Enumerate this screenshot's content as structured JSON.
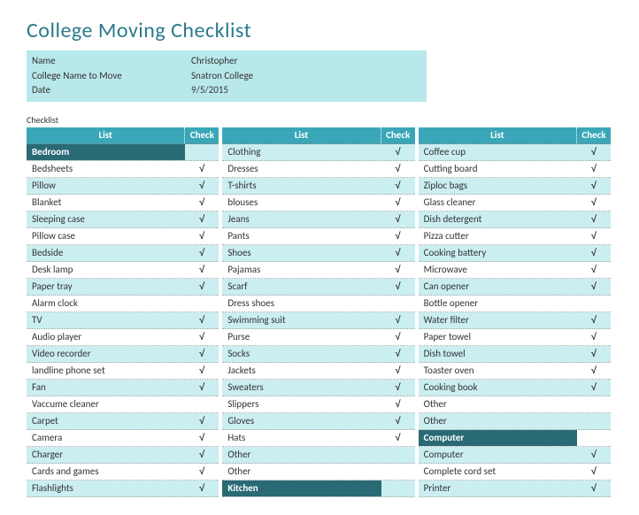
{
  "title": "College Moving Checklist",
  "info": {
    "name_label": "Name",
    "name_value": "Christopher",
    "college_label": "College Name to Move",
    "college_value": "Snatron College",
    "date_label": "Date",
    "date_value": "9/5/2015"
  },
  "section_label": "Checklist",
  "headers": {
    "list": "List",
    "check": "Check"
  },
  "checkmark": "√",
  "columns": [
    [
      {
        "label": "Bedroom",
        "check": "",
        "cat": true
      },
      {
        "label": "Bedsheets",
        "check": "√"
      },
      {
        "label": "Pillow",
        "check": "√"
      },
      {
        "label": "Blanket",
        "check": "√"
      },
      {
        "label": "Sleeping case",
        "check": "√"
      },
      {
        "label": "Pillow case",
        "check": "√"
      },
      {
        "label": "Bedside",
        "check": "√"
      },
      {
        "label": "Desk lamp",
        "check": "√"
      },
      {
        "label": "Paper tray",
        "check": "√"
      },
      {
        "label": "Alarm clock",
        "check": ""
      },
      {
        "label": "TV",
        "check": "√"
      },
      {
        "label": "Audio player",
        "check": "√"
      },
      {
        "label": "Video recorder",
        "check": "√"
      },
      {
        "label": "landline phone set",
        "check": "√"
      },
      {
        "label": "Fan",
        "check": "√"
      },
      {
        "label": "Vaccume cleaner",
        "check": ""
      },
      {
        "label": "Carpet",
        "check": "√"
      },
      {
        "label": "Camera",
        "check": "√"
      },
      {
        "label": "Charger",
        "check": "√"
      },
      {
        "label": "Cards and games",
        "check": "√"
      },
      {
        "label": "Flashlights",
        "check": "√"
      }
    ],
    [
      {
        "label": "Clothing",
        "check": "√"
      },
      {
        "label": "Dresses",
        "check": "√"
      },
      {
        "label": "T-shirts",
        "check": "√"
      },
      {
        "label": "blouses",
        "check": "√"
      },
      {
        "label": "Jeans",
        "check": "√"
      },
      {
        "label": "Pants",
        "check": "√"
      },
      {
        "label": "Shoes",
        "check": "√"
      },
      {
        "label": "Pajamas",
        "check": "√"
      },
      {
        "label": "Scarf",
        "check": "√"
      },
      {
        "label": "Dress shoes",
        "check": ""
      },
      {
        "label": "Swimming suit",
        "check": "√"
      },
      {
        "label": "Purse",
        "check": "√"
      },
      {
        "label": "Socks",
        "check": "√"
      },
      {
        "label": "Jackets",
        "check": "√"
      },
      {
        "label": "Sweaters",
        "check": "√"
      },
      {
        "label": "Slippers",
        "check": "√"
      },
      {
        "label": "Gloves",
        "check": "√"
      },
      {
        "label": "Hats",
        "check": "√"
      },
      {
        "label": "Other",
        "check": ""
      },
      {
        "label": "Other",
        "check": ""
      },
      {
        "label": "Kitchen",
        "check": "",
        "cat": true
      }
    ],
    [
      {
        "label": "Coffee cup",
        "check": "√"
      },
      {
        "label": "Cutting board",
        "check": "√"
      },
      {
        "label": "Ziploc bags",
        "check": "√"
      },
      {
        "label": "Glass cleaner",
        "check": "√"
      },
      {
        "label": "Dish detergent",
        "check": "√"
      },
      {
        "label": "Pizza cutter",
        "check": "√"
      },
      {
        "label": "Cooking battery",
        "check": "√"
      },
      {
        "label": "Microwave",
        "check": "√"
      },
      {
        "label": "Can opener",
        "check": "√"
      },
      {
        "label": "Bottle opener",
        "check": ""
      },
      {
        "label": "Water filter",
        "check": "√"
      },
      {
        "label": "Paper towel",
        "check": "√"
      },
      {
        "label": "Dish towel",
        "check": "√"
      },
      {
        "label": "Toaster oven",
        "check": "√"
      },
      {
        "label": "Cooking book",
        "check": "√"
      },
      {
        "label": "Other",
        "check": ""
      },
      {
        "label": "Other",
        "check": ""
      },
      {
        "label": "Computer",
        "check": "",
        "cat": true
      },
      {
        "label": "Computer",
        "check": "√"
      },
      {
        "label": "Complete cord set",
        "check": "√"
      },
      {
        "label": "Printer",
        "check": "√"
      }
    ]
  ]
}
